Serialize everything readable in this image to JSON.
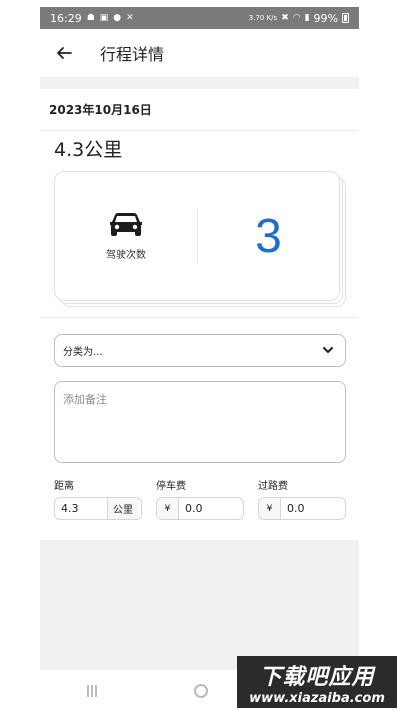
{
  "status_bar": {
    "time": "16:29",
    "net_speed": "3.70 K/s",
    "battery": "99%"
  },
  "header": {
    "title": "行程详情"
  },
  "trip": {
    "date": "2023年10月16日",
    "distance_display": "4.3公里"
  },
  "summary_card": {
    "label": "驾驶次数",
    "count": "3"
  },
  "category_select": {
    "selected": "分类为..."
  },
  "notes": {
    "placeholder": "添加备注"
  },
  "fields": {
    "distance": {
      "label": "距离",
      "value": "4.3",
      "unit": "公里"
    },
    "parking": {
      "label": "停车费",
      "currency": "¥",
      "value": "0.0"
    },
    "toll": {
      "label": "过路费",
      "currency": "¥",
      "value": "0.0"
    }
  },
  "watermark": {
    "line1": "下载吧应用",
    "line2": "www.xiazaiba.com"
  },
  "colors": {
    "accent": "#1a6fd6",
    "status_bar": "#7a7a7a"
  }
}
